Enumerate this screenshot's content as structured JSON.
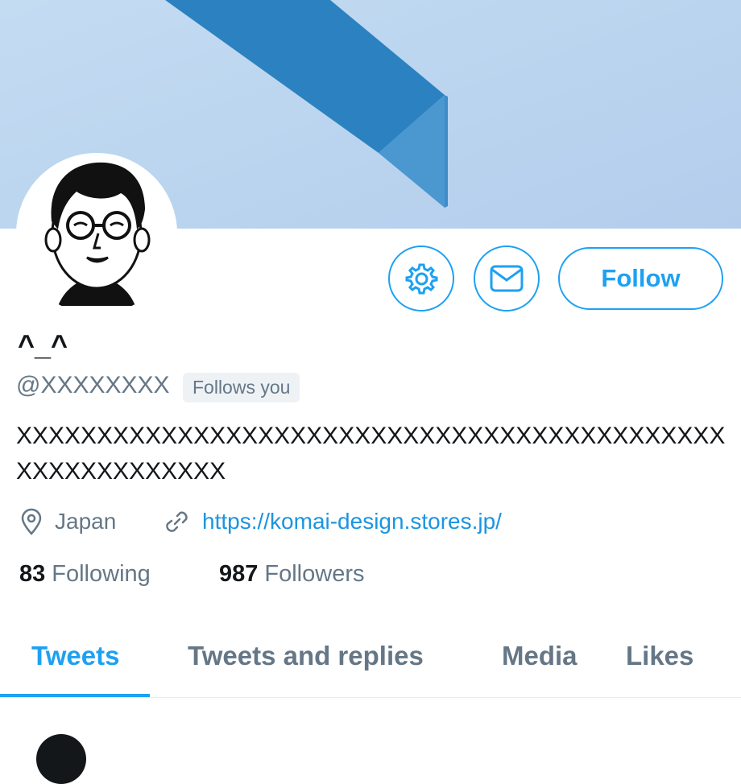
{
  "profile": {
    "display_name": "^_^",
    "handle": "@XXXXXXXX",
    "follows_you_badge": "Follows you",
    "bio": "XXXXXXXXXXXXXXXXXXXXXXXXXXXXXXXXXXXXXXXXXXXXXXXXXXXXXXXXX",
    "location": "Japan",
    "website": "https://komai-design.stores.jp/"
  },
  "actions": {
    "settings_icon": "gear-icon",
    "message_icon": "envelope-icon",
    "follow_label": "Follow"
  },
  "stats": {
    "following_count": "83",
    "following_label": "Following",
    "followers_count": "987",
    "followers_label": "Followers"
  },
  "tabs": [
    {
      "label": "Tweets",
      "active": true
    },
    {
      "label": "Tweets and replies",
      "active": false
    },
    {
      "label": "Media",
      "active": false
    },
    {
      "label": "Likes",
      "active": false
    }
  ],
  "colors": {
    "accent": "#1da1f2",
    "link": "#1b95e0",
    "secondary_text": "#657786",
    "primary_text": "#14171a",
    "banner": "#bad4ef"
  }
}
